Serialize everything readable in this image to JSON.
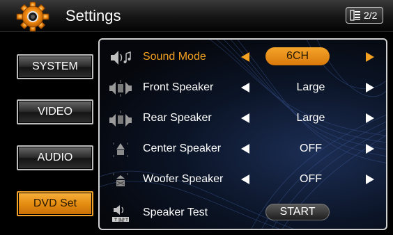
{
  "header": {
    "title": "Settings",
    "page_indicator": "2/2",
    "icon": "gear-icon"
  },
  "nav": [
    {
      "label": "SYSTEM",
      "active": false
    },
    {
      "label": "VIDEO",
      "active": false
    },
    {
      "label": "AUDIO",
      "active": false
    },
    {
      "label": "DVD Set",
      "active": true
    }
  ],
  "rows": [
    {
      "label": "Sound Mode",
      "value": "6CH",
      "icon": "sound-mode-icon",
      "active": true
    },
    {
      "label": "Front Speaker",
      "value": "Large",
      "icon": "front-speaker-icon",
      "active": false
    },
    {
      "label": "Rear Speaker",
      "value": "Large",
      "icon": "rear-speaker-icon",
      "active": false
    },
    {
      "label": "Center Speaker",
      "value": "OFF",
      "icon": "center-speaker-icon",
      "active": false
    },
    {
      "label": "Woofer Speaker",
      "value": "OFF",
      "icon": "woofer-speaker-icon",
      "active": false
    },
    {
      "label": "Speaker Test",
      "value": "START",
      "icon": "speaker-test-icon",
      "active": false
    }
  ],
  "colors": {
    "accent": "#f4a020",
    "panel_bg": "#0b1426"
  }
}
